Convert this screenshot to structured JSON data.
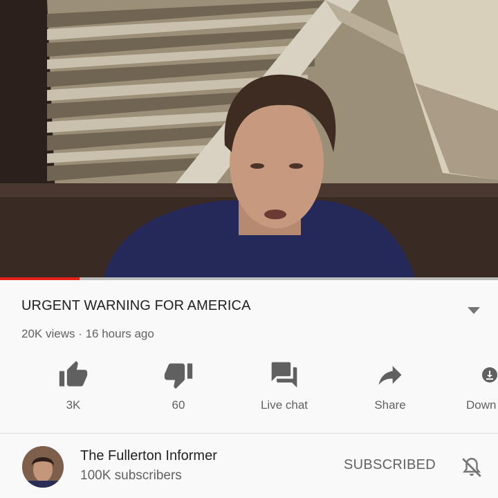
{
  "video": {
    "progress_fraction": 0.16
  },
  "info": {
    "title": "URGENT WARNING FOR AMERICA",
    "meta": "20K views · 16 hours ago"
  },
  "actions": {
    "like_count": "3K",
    "dislike_count": "60",
    "live_chat_label": "Live chat",
    "share_label": "Share",
    "download_label": "Down"
  },
  "channel": {
    "name": "The Fullerton Informer",
    "subscribers": "100K subscribers",
    "subscribe_state": "SUBSCRIBED"
  },
  "colors": {
    "accent": "#e62117",
    "icon": "#606060",
    "text_primary": "#212121",
    "text_secondary": "#616161"
  },
  "icons": [
    "thumbs-up-icon",
    "thumbs-down-icon",
    "live-chat-icon",
    "share-icon",
    "download-icon",
    "bell-off-icon",
    "expand-chevron-icon"
  ]
}
